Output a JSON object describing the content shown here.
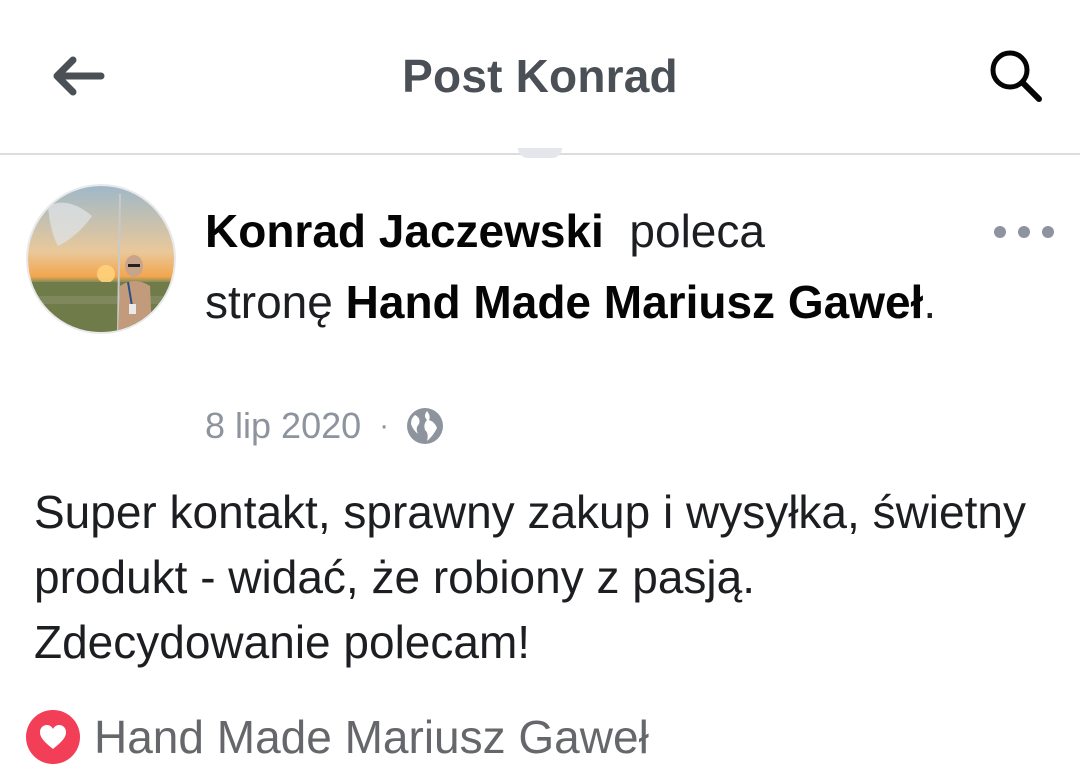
{
  "topbar": {
    "title": "Post Konrad",
    "back_icon": "arrow-left-icon",
    "search_icon": "search-icon"
  },
  "post": {
    "author": "Konrad Jaczewski",
    "verb": "poleca",
    "object_prefix": "stronę",
    "page_name": "Hand Made Mariusz Gaweł",
    "trailing": ".",
    "date": "8 lip 2020",
    "separator": "·",
    "audience_icon": "globe-icon",
    "more_icon": "more-horizontal-icon",
    "body": "Super kontakt, sprawny zakup i wysyłka, świetny produkt - widać, że robiony z pasją. Zdecydowanie polecam!",
    "recommended_page": "Hand Made Mariusz Gaweł",
    "recommended_icon": "heart-icon"
  },
  "colors": {
    "title": "#4b4f56",
    "text": "#1c1e21",
    "meta": "#8d949e",
    "heart": "#f33e58"
  }
}
